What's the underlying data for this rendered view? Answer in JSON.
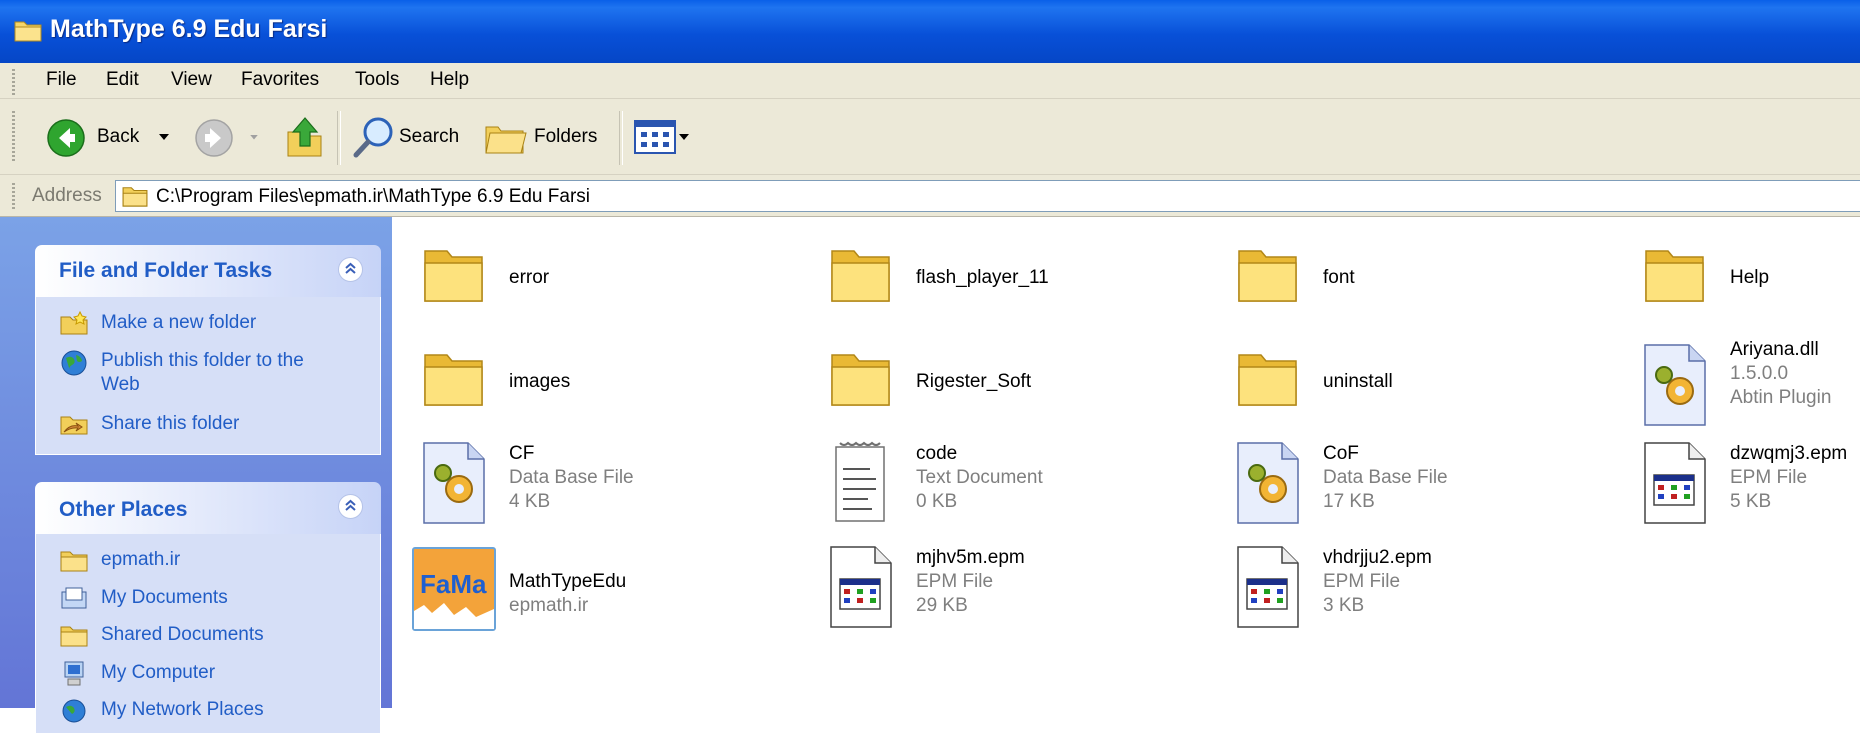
{
  "window": {
    "title": "MathType 6.9 Edu Farsi"
  },
  "menu": [
    {
      "label": "File"
    },
    {
      "label": "Edit"
    },
    {
      "label": "View"
    },
    {
      "label": "Favorites"
    },
    {
      "label": "Tools"
    },
    {
      "label": "Help"
    }
  ],
  "toolbar": {
    "back": "Back",
    "search": "Search",
    "folders": "Folders"
  },
  "address": {
    "label": "Address",
    "path": "C:\\Program Files\\epmath.ir\\MathType 6.9 Edu Farsi"
  },
  "tasks_panel": {
    "title": "File and Folder Tasks",
    "items": [
      {
        "label": "Make a new folder",
        "icon": "new-folder-icon"
      },
      {
        "label": "Publish this folder to the",
        "label2": "Web",
        "icon": "globe-icon"
      },
      {
        "label": "Share this folder",
        "icon": "share-folder-icon"
      }
    ]
  },
  "places_panel": {
    "title": "Other Places",
    "items": [
      {
        "label": "epmath.ir",
        "icon": "folder-icon"
      },
      {
        "label": "My Documents",
        "icon": "documents-icon"
      },
      {
        "label": "Shared Documents",
        "icon": "folder-icon"
      },
      {
        "label": "My Computer",
        "icon": "computer-icon"
      },
      {
        "label": "My Network Places",
        "icon": "network-icon"
      }
    ]
  },
  "files": [
    {
      "name": "error",
      "type": "folder"
    },
    {
      "name": "flash_player_11",
      "type": "folder"
    },
    {
      "name": "font",
      "type": "folder"
    },
    {
      "name": "Help",
      "type": "folder"
    },
    {
      "name": "images",
      "type": "folder"
    },
    {
      "name": "Rigester_Soft",
      "type": "folder"
    },
    {
      "name": "uninstall",
      "type": "folder"
    },
    {
      "name": "Ariyana.dll",
      "type": "dll",
      "line2": "1.5.0.0",
      "line3": "Abtin Plugin"
    },
    {
      "name": "CF",
      "type": "dll",
      "line2": "Data Base File",
      "line3": "4 KB"
    },
    {
      "name": "code",
      "type": "text",
      "line2": "Text Document",
      "line3": "0 KB"
    },
    {
      "name": "CoF",
      "type": "dll",
      "line2": "Data Base File",
      "line3": "17 KB"
    },
    {
      "name": "dzwqmj3.epm",
      "type": "epm",
      "line2": "EPM File",
      "line3": "5 KB"
    },
    {
      "name": "MathTypeEdu",
      "type": "app",
      "line2": "epmath.ir",
      "logo": "FaMa"
    },
    {
      "name": "mjhv5m.epm",
      "type": "epm",
      "line2": "EPM File",
      "line3": "29 KB"
    },
    {
      "name": "vhdrjju2.epm",
      "type": "epm",
      "line2": "EPM File",
      "line3": "3 KB"
    }
  ]
}
